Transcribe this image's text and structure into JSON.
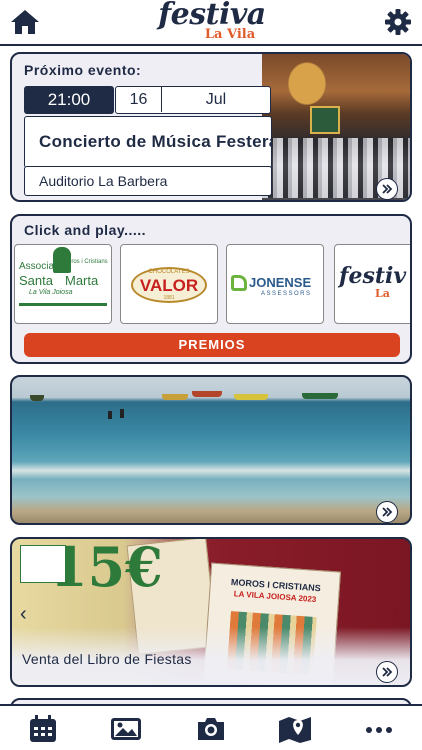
{
  "header": {
    "logo_line1": "festiva",
    "logo_line2": "La Vila",
    "icons": [
      "home-icon",
      "gear-icon"
    ]
  },
  "next_event": {
    "label": "Próximo evento:",
    "time": "21:00",
    "day": "16",
    "month": "Jul",
    "name": "Concierto de Música Festera",
    "venue": "Auditorio La Barbera"
  },
  "click_and_play": {
    "label": "Click and play.....",
    "sponsors": [
      {
        "line1": "Associació",
        "line2": "Santa",
        "line3": "Marta",
        "sub": "La Vila Joiosa",
        "tag": "Moros i Cristians"
      },
      {
        "brand": "VALOR",
        "sub_top": "CHOCOLATES",
        "sub_bottom": "1881"
      },
      {
        "brand": "JONENSE",
        "sub": "ASSESSORS"
      },
      {
        "brand": "festiv",
        "sub": "La"
      }
    ],
    "prize_button": "PREMIOS"
  },
  "book": {
    "price": "15€",
    "caption": "Venta del Libro de Fiestas",
    "poster_line1": "MOROS I CRISTIANS",
    "poster_line2": "LA VILA JOIOSA 2023"
  },
  "bottom_nav": [
    "calendar-icon",
    "image-icon",
    "camera-icon",
    "map-icon",
    "more-icon"
  ],
  "colors": {
    "navy": "#1f2a44",
    "accent": "#e05a2a",
    "prize": "#d9431f"
  }
}
